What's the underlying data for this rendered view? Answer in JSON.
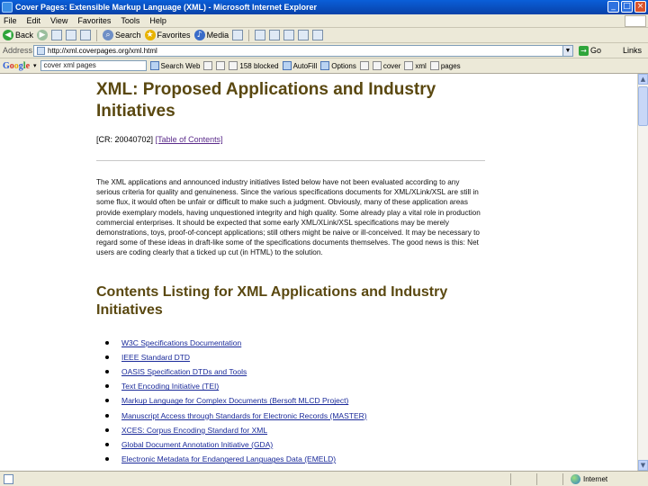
{
  "window": {
    "title": "Cover Pages: Extensible Markup Language (XML) - Microsoft Internet Explorer"
  },
  "menubar": {
    "items": [
      "File",
      "Edit",
      "View",
      "Favorites",
      "Tools",
      "Help"
    ]
  },
  "toolbar": {
    "back_label": "Back",
    "search_label": "Search",
    "favorites_label": "Favorites",
    "media_label": "Media"
  },
  "address": {
    "label": "Address",
    "url": "http://xml.coverpages.org/xml.html",
    "go_label": "Go",
    "links_label": "Links"
  },
  "google": {
    "logo": [
      "G",
      "o",
      "o",
      "g",
      "l",
      "e"
    ],
    "query": "cover xml pages",
    "search_web_label": "Search Web",
    "blocked_label": "158 blocked",
    "autofill_label": "AutoFill",
    "options_label": "Options",
    "word1": "cover",
    "word2": "xml",
    "word3": "pages"
  },
  "page": {
    "title": "XML: Proposed Applications and Industry Initiatives",
    "cite_prefix": "[CR: 20040702]",
    "toc_link": "[Table of Contents]",
    "intro": "The XML applications and announced industry initiatives listed below have not been evaluated according to any serious criteria for quality and genuineness. Since the various specifications documents for XML/XLink/XSL are still in some flux, it would often be unfair or difficult to make such a judgment. Obviously, many of these application areas provide exemplary models, having unquestioned integrity and high quality. Some already play a vital role in production commercial enterprises. It should be expected that some early XML/XLink/XSL specifications may be merely demonstrations, toys, proof-of-concept applications; still others might be naive or ill-conceived. It may be necessary to regard some of these ideas in draft-like some of the specifications documents themselves. The good news is this: Net users are coding clearly that a ticked up cut (in HTML) to the solution.",
    "contents_heading": "Contents Listing for XML Applications and Industry Initiatives",
    "links": [
      "W3C Specifications Documentation",
      "IEEE Standard DTD",
      "OASIS Specification DTDs and Tools",
      "Text Encoding Initiative (TEI)",
      "Markup Language for Complex Documents (Bersoft MLCD Project)",
      "Manuscript Access through Standards for Electronic Records (MASTER)",
      "XCES: Corpus Encoding Standard for XML",
      "Global Document Annotation Initiative (GDA)",
      "Electronic Metadata for Endangered Languages Data (EMELD)"
    ]
  },
  "status": {
    "zone_label": "Internet"
  }
}
